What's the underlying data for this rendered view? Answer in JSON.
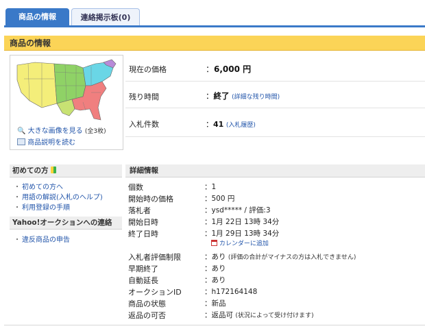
{
  "tabs": [
    {
      "label": "商品の情報"
    },
    {
      "label": "連絡掲示板(0)"
    }
  ],
  "section_title": "商品の情報",
  "image_panel": {
    "enlarge_label": "大きな画像を見る",
    "enlarge_count": "(全3枚)",
    "read_desc_label": "商品説明を読む"
  },
  "summary": {
    "price_label": "現在の価格",
    "price_value": "6,000 円",
    "remaining_label": "残り時間",
    "remaining_value": "終了",
    "remaining_link": "(詳細な残り時間)",
    "bids_label": "入札件数",
    "bids_value": "41",
    "bids_link": "(入札履歴)"
  },
  "sidebar": {
    "beginner_title": "初めての方",
    "beginner_links": [
      "初めての方へ",
      "用語の解説(入札のヘルプ)",
      "利用登録の手順"
    ],
    "contact_title": "Yahoo!オークションへの連絡",
    "contact_links": [
      "違反商品の申告"
    ]
  },
  "details": {
    "title": "詳細情報",
    "rows": [
      {
        "label": "個数",
        "value": "1"
      },
      {
        "label": "開始時の価格",
        "value": "500 円"
      },
      {
        "label": "落札者",
        "value": "ysd***** / 評価:3"
      },
      {
        "label": "開始日時",
        "value": "1月 22日 13時 34分"
      },
      {
        "label": "終了日時",
        "value": "1月 29日 13時 34分"
      },
      {
        "label": "入札者評価制限",
        "value": "あり",
        "note": "(評価の合計がマイナスの方は入札できません)"
      },
      {
        "label": "早期終了",
        "value": "あり"
      },
      {
        "label": "自動延長",
        "value": "あり"
      },
      {
        "label": "オークションID",
        "value": "h172164148"
      },
      {
        "label": "商品の状態",
        "value": "新品"
      },
      {
        "label": "返品の可否",
        "value": "返品可",
        "note": "(状況によって受け付けます)"
      }
    ],
    "calendar_link": "カレンダーに追加"
  },
  "colors": {
    "tab_active": "#3a79c8",
    "section_header": "#fbd457",
    "link": "#2255aa"
  }
}
